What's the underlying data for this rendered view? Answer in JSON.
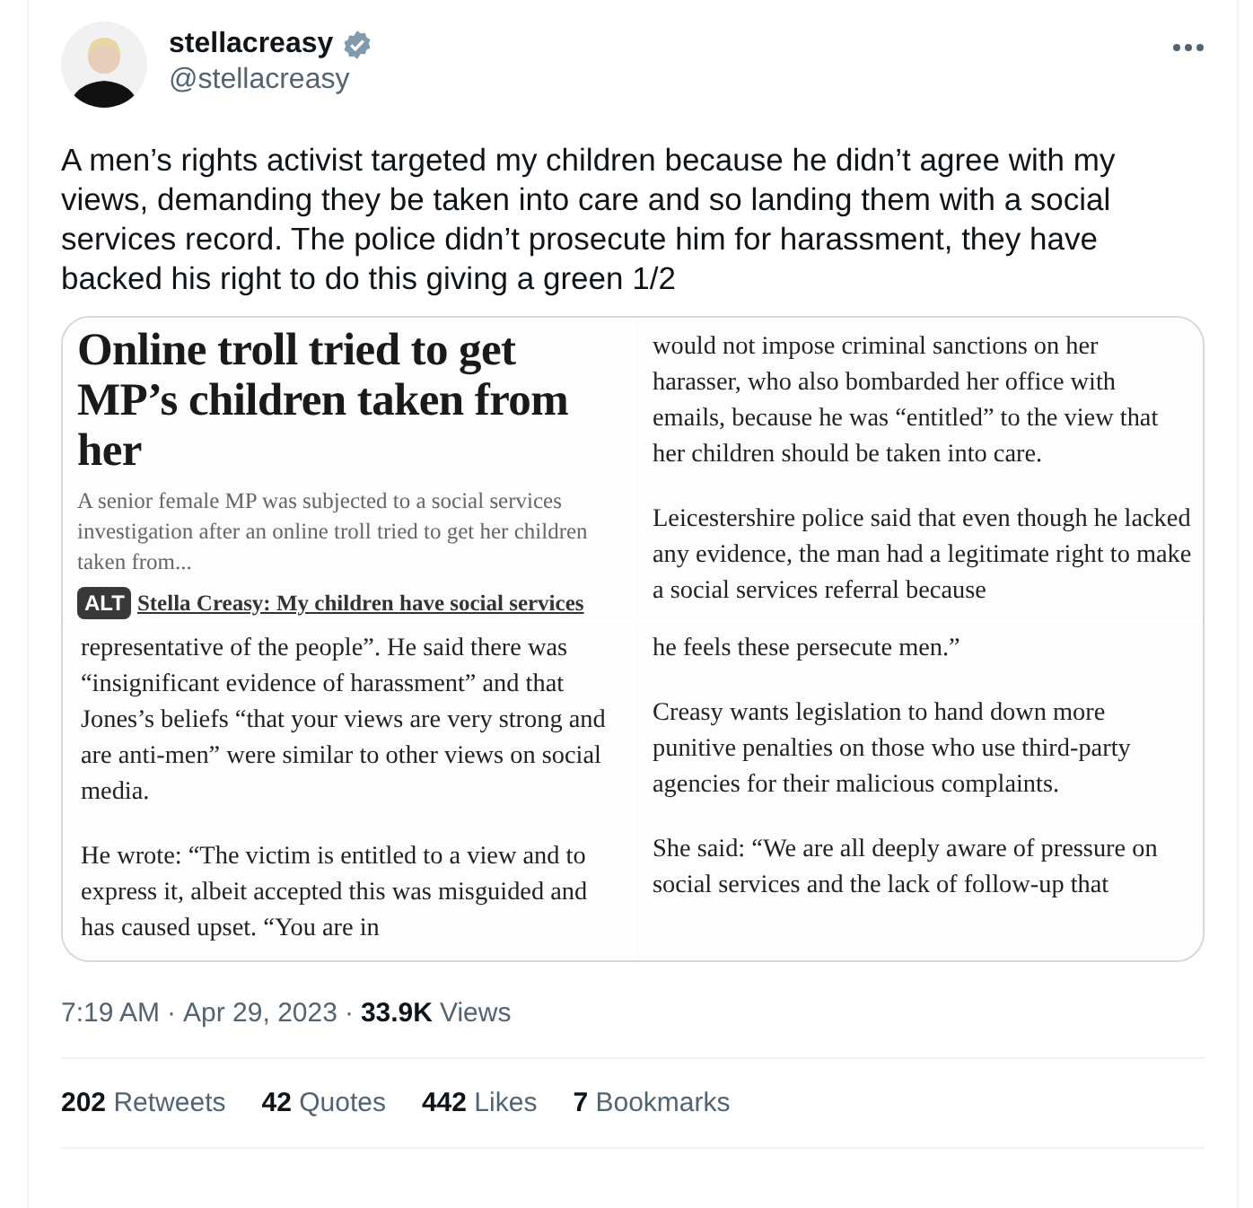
{
  "author": {
    "name": "stellacreasy",
    "handle": "@stellacreasy",
    "verified": true
  },
  "tweet_text": "A men’s rights activist targeted my children because he didn’t agree with my views, demanding they be taken into care and so landing them with a social services record. The police didn’t prosecute him for harassment, they have backed his right to do this giving a green 1/2",
  "media": [
    {
      "kind": "headline",
      "headline": "Online troll tried to get MP’s children taken from her",
      "standfirst": "A senior female MP was subjected to a social services investigation after an online troll tried to get her children taken from...",
      "related_link": "Stella Creasy: My children have social services",
      "alt_badge": "ALT"
    },
    {
      "kind": "body",
      "paragraphs": [
        "would not impose criminal sanctions on her harasser, who also bombarded her office with emails, because he was “entitled” to the view that her children should be taken into care.",
        "Leicestershire police said that even though he lacked any evidence, the man had a legitimate right to make a social services referral because"
      ]
    },
    {
      "kind": "body",
      "paragraphs": [
        "representative of the people”. He said there was “insignificant evidence of harassment” and that Jones’s beliefs “that your views are very strong and are anti-men” were similar to other views on social media.",
        "He wrote: “The victim is entitled to a view and to express it, albeit accepted this was misguided and has caused upset. “You are in"
      ]
    },
    {
      "kind": "body",
      "paragraphs": [
        "he feels these persecute men.”",
        "Creasy wants legislation to hand down more punitive penalties on those who use third-party agencies for their malicious complaints.",
        "She said: “We are all deeply aware of pressure on social services and the lack of follow-up that"
      ]
    }
  ],
  "meta": {
    "time": "7:19 AM",
    "separator": "·",
    "date": "Apr 29, 2023",
    "views_count": "33.9K",
    "views_label": "Views"
  },
  "stats": [
    {
      "count": "202",
      "label": "Retweets"
    },
    {
      "count": "42",
      "label": "Quotes"
    },
    {
      "count": "442",
      "label": "Likes"
    },
    {
      "count": "7",
      "label": "Bookmarks"
    }
  ]
}
